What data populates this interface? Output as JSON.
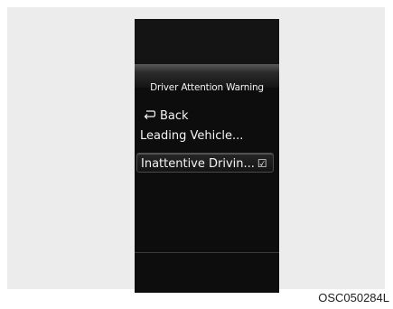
{
  "menu": {
    "title": "Driver Attention Warning",
    "items": [
      {
        "label": "Back",
        "icon": "back-arrow-icon"
      },
      {
        "label": "Leading Vehicle..."
      },
      {
        "label": "Inattentive Drivin...",
        "checked": true
      }
    ],
    "checkbox_glyph": "☑"
  },
  "caption": "OSC050284L",
  "colors": {
    "screen_bg": "#0d0d0d",
    "frame_bg": "#ececec",
    "text": "#f4f4f4",
    "selection_border": "#4a4a4a"
  }
}
